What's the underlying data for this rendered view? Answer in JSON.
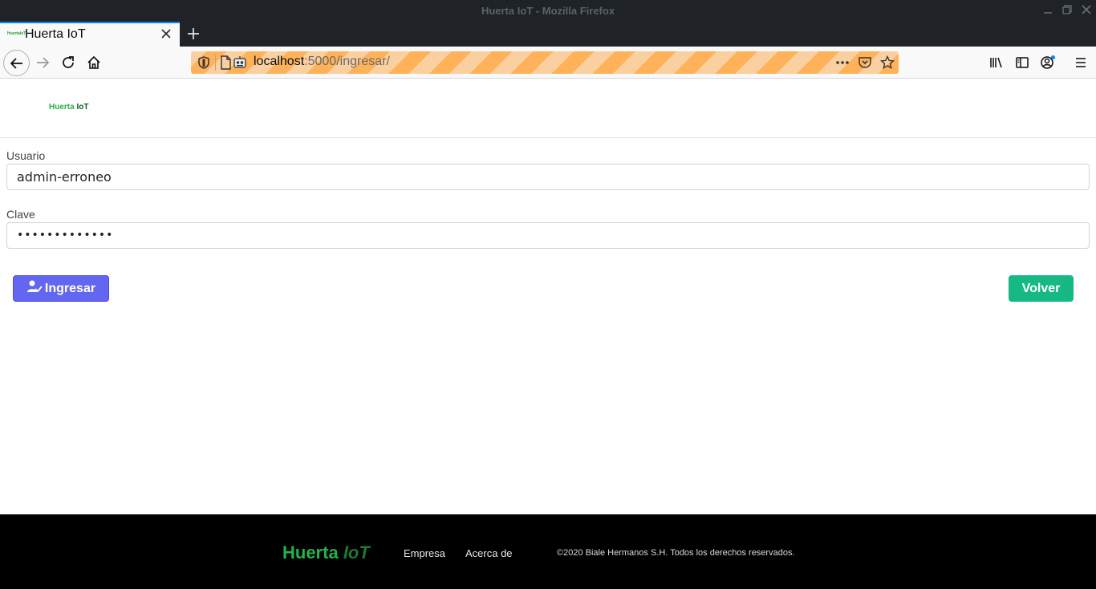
{
  "window": {
    "title": "Huerta IoT - Mozilla Firefox"
  },
  "tab": {
    "label": "Huerta IoT",
    "favicon_text": "HuertaIoT"
  },
  "url": {
    "host": "localhost",
    "rest": ":5000/ingresar/"
  },
  "header": {
    "brand_part1": "Huerta",
    "brand_part2": "IoT"
  },
  "form": {
    "usuario_label": "Usuario",
    "usuario_value": "admin-erroneo",
    "clave_label": "Clave",
    "clave_value": "•••••••••••••",
    "ingresar_label": "Ingresar",
    "volver_label": "Volver"
  },
  "footer": {
    "brand_part1": "Huerta",
    "brand_part2": "IoT",
    "links": [
      "Empresa",
      "Acerca de"
    ],
    "copyright": "©2020 Biale Hermanos S.H. Todos los derechos reservados."
  },
  "colors": {
    "primary_button": "#6366f1",
    "success_button": "#16b885",
    "brand_green": "#24b24a",
    "brand_dark_green": "#0f5c1f",
    "footer_bg": "#000000"
  },
  "icons": {
    "ingresar": "user-check-icon"
  }
}
